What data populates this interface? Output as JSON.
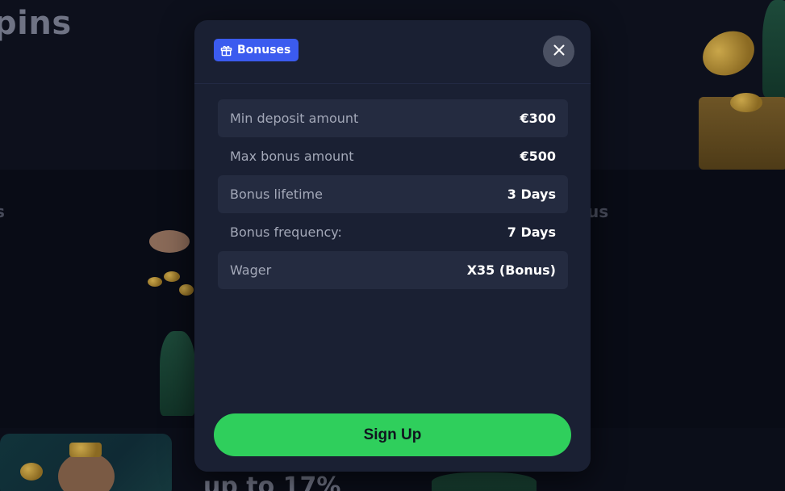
{
  "background": {
    "heading_fragment": "pins",
    "left_fragment": "s",
    "right_fragment": "us",
    "bottom_fragment": "up to 17%"
  },
  "modal": {
    "badge_label": "Bonuses",
    "badge_color": "#3b5bef",
    "rows": [
      {
        "label": "Min deposit amount",
        "value": "€300"
      },
      {
        "label": "Max bonus amount",
        "value": "€500"
      },
      {
        "label": "Bonus lifetime",
        "value": "3 Days"
      },
      {
        "label": "Bonus frequency:",
        "value": "7 Days"
      },
      {
        "label": "Wager",
        "value": "X35 (Bonus)"
      }
    ],
    "signup_label": "Sign Up",
    "signup_color": "#2fcf5c"
  }
}
